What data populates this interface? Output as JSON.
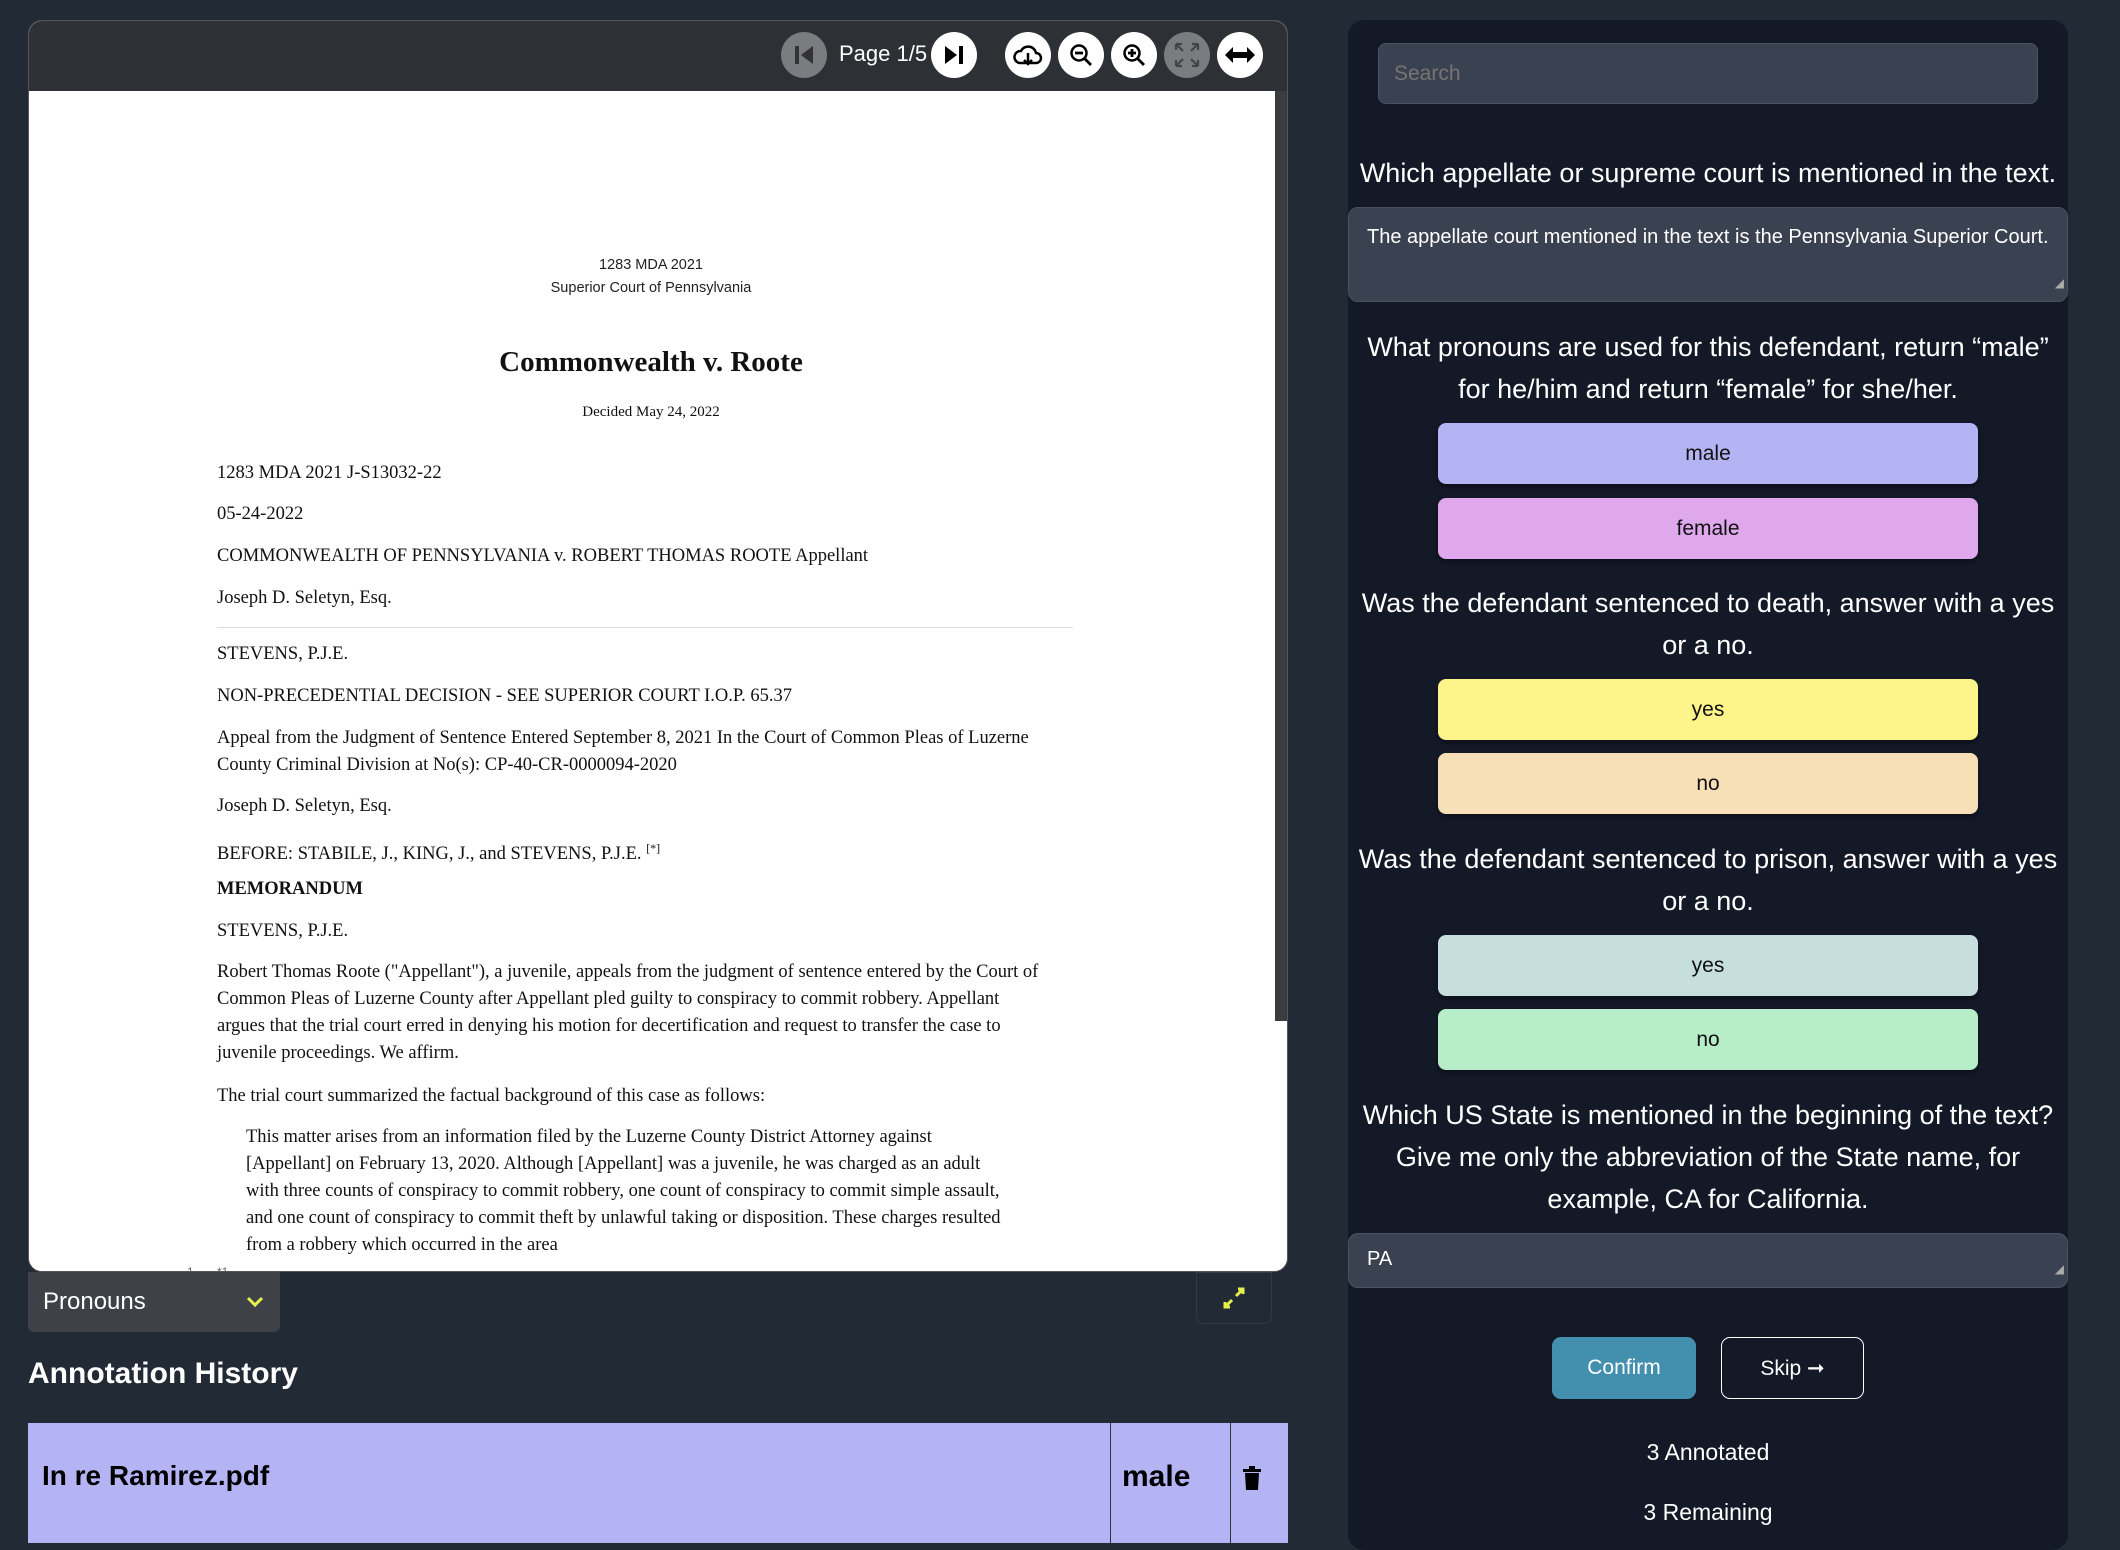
{
  "viewer": {
    "page_label": "Page 1/5",
    "toolbar_icons": [
      "first-page-icon",
      "last-page-icon",
      "cloud-download-icon",
      "zoom-out-icon",
      "zoom-in-icon",
      "fit-screen-icon",
      "fit-width-icon"
    ]
  },
  "document": {
    "header_line1": "1283 MDA 2021",
    "header_line2": "Superior Court of Pennsylvania",
    "title": "Commonwealth v. Roote",
    "decided": "Decided May 24, 2022",
    "lines": [
      "1283 MDA 2021 J-S13032-22",
      "05-24-2022",
      "COMMONWEALTH OF PENNSYLVANIA v. ROBERT THOMAS ROOTE Appellant",
      "Joseph D. Seletyn, Esq.",
      "STEVENS, P.J.E.",
      "NON-PRECEDENTIAL DECISION - SEE SUPERIOR COURT I.O.P. 65.37",
      "Appeal from the Judgment of Sentence Entered September 8, 2021 In the Court of Common Pleas of Luzerne",
      "County Criminal Division at No(s): CP-40-CR-0000094-2020",
      "Joseph D. Seletyn, Esq.",
      "BEFORE: STABILE, J., KING, J., and STEVENS, P.J.E.",
      "MEMORANDUM",
      "STEVENS, P.J.E.",
      "Robert Thomas Roote (\"Appellant\"), a juvenile, appeals from the judgment of sentence entered by the Court of",
      "Common Pleas of Luzerne County after Appellant pled guilty to conspiracy to commit robbery. Appellant",
      "argues that the trial court erred in denying his motion for decertification and request to transfer the case to",
      "juvenile proceedings. We affirm.",
      "The trial court summarized the factual background of this case as follows:",
      "This matter arises from an information filed by the Luzerne County District Attorney against",
      "[Appellant] on February 13, 2020. Although [Appellant] was a juvenile, he was charged as an adult",
      "with three counts of conspiracy to commit robbery, one count of conspiracy to commit simple assault,",
      "and one count of conspiracy to commit theft by unlawful taking or disposition. These charges resulted",
      "from a robbery which occurred in the area"
    ],
    "footnote_ref": "[*]",
    "page_marker": "1",
    "page_marker2": "*1"
  },
  "controls": {
    "category_select": "Pronouns",
    "expand_icon": "expand-icon"
  },
  "history": {
    "title": "Annotation History",
    "rows": [
      {
        "file": "In re Ramirez.pdf",
        "value": "male",
        "color": "#b4b4f5"
      }
    ]
  },
  "panel": {
    "search_placeholder": "Search",
    "q1": "Which appellate or supreme court is mentioned in the text.",
    "a1": "The appellate court mentioned in the text is the Pennsylvania Superior Court.",
    "q2": "What pronouns are used for this defendant, return “male” for he/him and return “female” for she/her.",
    "q2_options": [
      {
        "label": "male",
        "color": "#b4b4f5"
      },
      {
        "label": "female",
        "color": "#e0a8ec"
      }
    ],
    "q3": "Was the defendant sentenced to death, answer with a yes or a no.",
    "q3_options": [
      {
        "label": "yes",
        "color": "#fdf58a"
      },
      {
        "label": "no",
        "color": "#f7e0b8"
      }
    ],
    "q4": "Was the defendant sentenced to prison, answer with a yes or a no.",
    "q4_options": [
      {
        "label": "yes",
        "color": "#c6dedd"
      },
      {
        "label": "no",
        "color": "#b7edc9"
      }
    ],
    "q5": "Which US State is mentioned in the beginning of the text? Give me only the abbreviation of the State name, for example, CA for California.",
    "a5": "PA",
    "confirm": "Confirm",
    "skip": "Skip ➞",
    "annotated": "3 Annotated",
    "remaining": "3 Remaining",
    "accent": "#4290ad"
  }
}
